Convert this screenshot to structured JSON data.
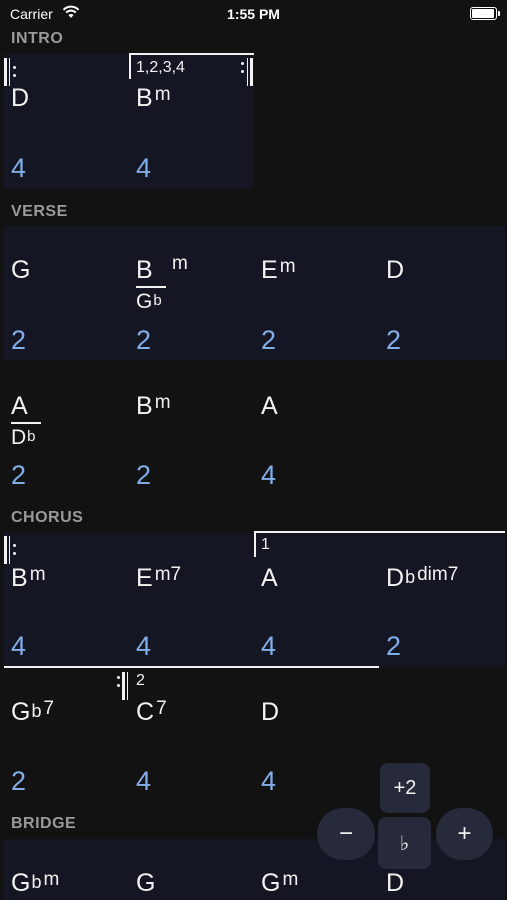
{
  "status_bar": {
    "carrier": "Carrier",
    "time": "1:55 PM"
  },
  "sections": {
    "intro": {
      "label": "INTRO",
      "ending": "1,2,3,4",
      "bars": [
        {
          "root": "D",
          "quality": "",
          "beats": "4"
        },
        {
          "root": "B",
          "quality": "m",
          "beats": "4"
        }
      ]
    },
    "verse": {
      "label": "VERSE",
      "rows": [
        [
          {
            "root": "G",
            "quality": "",
            "beats": "2"
          },
          {
            "root": "B",
            "quality": "m",
            "bass": "G",
            "bass_acc": "b",
            "beats": "2"
          },
          {
            "root": "E",
            "quality": "m",
            "beats": "2"
          },
          {
            "root": "D",
            "quality": "",
            "beats": "2"
          }
        ],
        [
          {
            "root": "A",
            "quality": "",
            "bass": "D",
            "bass_acc": "b",
            "beats": "2"
          },
          {
            "root": "B",
            "quality": "m",
            "beats": "2"
          },
          {
            "root": "A",
            "quality": "",
            "beats": "4"
          }
        ]
      ]
    },
    "chorus": {
      "label": "CHORUS",
      "ending1": "1",
      "ending2": "2",
      "rows": [
        [
          {
            "root": "B",
            "quality": "m",
            "beats": "4"
          },
          {
            "root": "E",
            "quality": "m7",
            "beats": "4"
          },
          {
            "root": "A",
            "quality": "",
            "beats": "4"
          },
          {
            "root": "D",
            "acc": "b",
            "quality": "dim7",
            "beats": "2"
          }
        ],
        [
          {
            "root": "G",
            "acc": "b",
            "quality": "7",
            "beats": "2"
          },
          {
            "root": "C",
            "quality": "7",
            "beats": "4"
          },
          {
            "root": "D",
            "quality": "",
            "beats": "4"
          }
        ]
      ]
    },
    "bridge": {
      "label": "BRIDGE",
      "bars": [
        {
          "root": "G",
          "acc": "b",
          "quality": "m"
        },
        {
          "root": "G",
          "quality": ""
        },
        {
          "root": "G",
          "quality": "m"
        },
        {
          "root": "D",
          "quality": ""
        }
      ]
    }
  },
  "transpose": {
    "amount": "+2",
    "minus_label": "−",
    "accidental_label": "♭",
    "plus_label": "+"
  }
}
